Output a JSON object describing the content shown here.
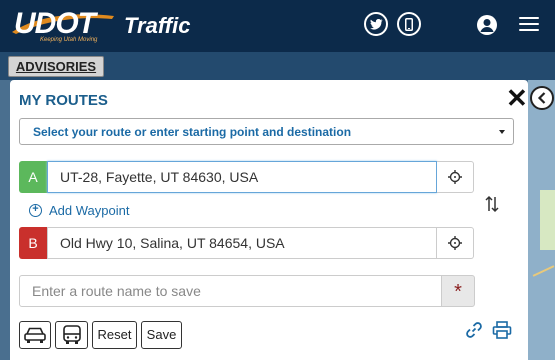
{
  "header": {
    "logo_text": "UDOT",
    "logo_tagline": "Keeping Utah Moving",
    "app_title": "Traffic",
    "icons": [
      "twitter-icon",
      "mobile-icon",
      "user-icon",
      "menu-icon"
    ]
  },
  "advisories": {
    "label": "ADVISORIES"
  },
  "panel": {
    "title": "MY ROUTES",
    "route_select": {
      "value": "Select your route or enter starting point and destination"
    },
    "point_a": {
      "badge": "A",
      "value": "UT-28, Fayette, UT 84630, USA",
      "badge_color": "#5cb85c"
    },
    "point_b": {
      "badge": "B",
      "value": "Old Hwy 10, Salina, UT 84654, USA",
      "badge_color": "#c9302c"
    },
    "add_waypoint": "Add Waypoint",
    "route_name": {
      "placeholder": "Enter a route name to save",
      "required_marker": "*"
    },
    "buttons": {
      "reset": "Reset",
      "save": "Save"
    }
  },
  "colors": {
    "header_bg": "#0c2a4a",
    "accent": "#1b6aa5",
    "title": "#1b5e8c"
  }
}
